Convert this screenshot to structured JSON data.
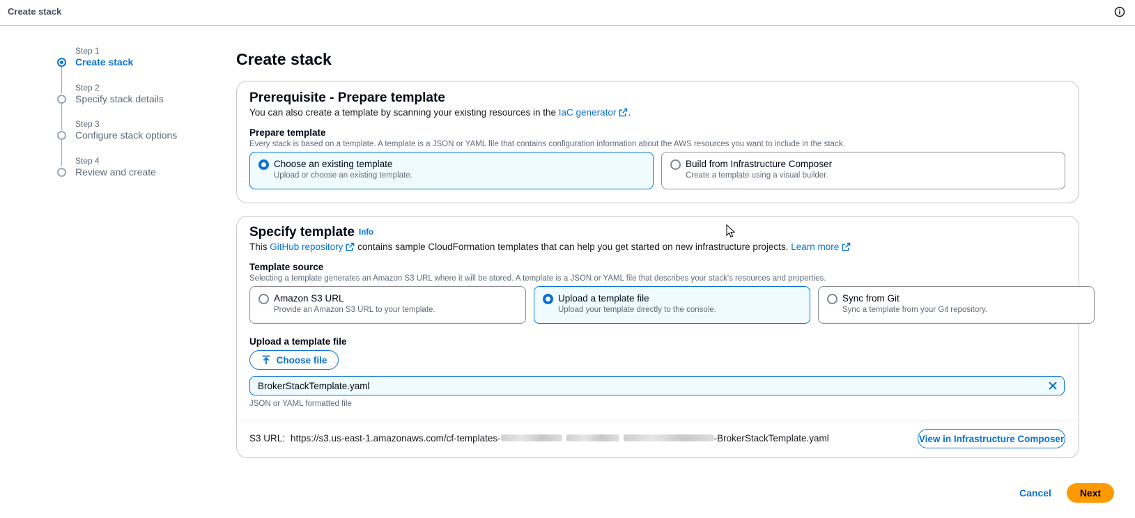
{
  "header": {
    "title": "Create stack",
    "info_icon": "info-icon"
  },
  "steps": [
    {
      "num": "Step 1",
      "label": "Create stack",
      "active": true
    },
    {
      "num": "Step 2",
      "label": "Specify stack details",
      "active": false
    },
    {
      "num": "Step 3",
      "label": "Configure stack options",
      "active": false
    },
    {
      "num": "Step 4",
      "label": "Review and create",
      "active": false
    }
  ],
  "page_title": "Create stack",
  "prerequisite": {
    "heading": "Prerequisite - Prepare template",
    "desc_prefix": "You can also create a template by scanning your existing resources in the",
    "desc_link": "IaC generator",
    "desc_suffix": ".",
    "prepare_label": "Prepare template",
    "prepare_desc": "Every stack is based on a template. A template is a JSON or YAML file that contains configuration information about the AWS resources you want to include in the stack.",
    "options": [
      {
        "title": "Choose an existing template",
        "desc": "Upload or choose an existing template.",
        "selected": true
      },
      {
        "title": "Build from Infrastructure Composer",
        "desc": "Create a template using a visual builder.",
        "selected": false
      }
    ]
  },
  "specify": {
    "heading": "Specify template",
    "info": "Info",
    "desc_prefix": "This",
    "desc_link1": "GitHub repository",
    "desc_middle": "contains sample CloudFormation templates that can help you get started on new infrastructure projects.",
    "desc_link2": "Learn more",
    "source_label": "Template source",
    "source_desc": "Selecting a template generates an Amazon S3 URL where it will be stored. A template is a JSON or YAML file that describes your stack's resources and properties.",
    "options": [
      {
        "title": "Amazon S3 URL",
        "desc": "Provide an Amazon S3 URL to your template.",
        "selected": false
      },
      {
        "title": "Upload a template file",
        "desc": "Upload your template directly to the console.",
        "selected": true
      },
      {
        "title": "Sync from Git",
        "desc": "Sync a template from your Git repository.",
        "selected": false
      }
    ],
    "upload_label": "Upload a template file",
    "choose_file": "Choose file",
    "file_name": "BrokerStackTemplate.yaml",
    "file_hint": "JSON or YAML formatted file",
    "s3_label": "S3 URL:",
    "s3_url_prefix": "https://s3.us-east-1.amazonaws.com/cf-templates-",
    "s3_url_suffix": "-BrokerStackTemplate.yaml",
    "view_button": "View in Infrastructure Composer"
  },
  "footer": {
    "cancel": "Cancel",
    "next": "Next"
  },
  "colors": {
    "accent": "#0972d3",
    "primary_button": "#ff9900",
    "selected_bg": "#f0fbff"
  }
}
